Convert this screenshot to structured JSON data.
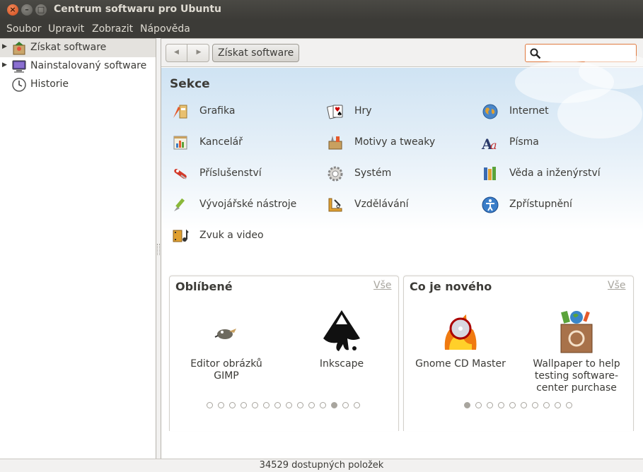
{
  "window": {
    "title": "Centrum softwaru pro Ubuntu",
    "close_glyph": "×",
    "min_glyph": "–",
    "max_glyph": "□"
  },
  "menubar": {
    "items": [
      "Soubor",
      "Upravit",
      "Zobrazit",
      "Nápověda"
    ]
  },
  "sidebar": {
    "items": [
      {
        "label": "Získat software",
        "icon": "get-software-icon",
        "expandable": true,
        "selected": true
      },
      {
        "label": "Nainstalovaný software",
        "icon": "computer-icon",
        "expandable": true,
        "selected": false
      },
      {
        "label": "Historie",
        "icon": "clock-icon",
        "expandable": false,
        "selected": false
      }
    ]
  },
  "toolbar": {
    "back_glyph": "◀",
    "forward_glyph": "▶",
    "breadcrumb": "Získat software",
    "search_placeholder": "",
    "search_value": ""
  },
  "sections": {
    "title": "Sekce",
    "categories": [
      {
        "label": "Grafika",
        "icon": "graphics-icon"
      },
      {
        "label": "Hry",
        "icon": "games-icon"
      },
      {
        "label": "Internet",
        "icon": "internet-icon"
      },
      {
        "label": "Kancelář",
        "icon": "office-icon"
      },
      {
        "label": "Motivy a tweaky",
        "icon": "themes-icon"
      },
      {
        "label": "Písma",
        "icon": "fonts-icon"
      },
      {
        "label": "Příslušenství",
        "icon": "accessories-icon"
      },
      {
        "label": "Systém",
        "icon": "system-icon"
      },
      {
        "label": "Věda a inženýrství",
        "icon": "science-icon"
      },
      {
        "label": "Vývojářské nástroje",
        "icon": "developer-tools-icon"
      },
      {
        "label": "Vzdělávání",
        "icon": "education-icon"
      },
      {
        "label": "Zpřístupnění",
        "icon": "accessibility-icon"
      },
      {
        "label": "Zvuk a video",
        "icon": "sound-video-icon"
      }
    ]
  },
  "featured": {
    "title": "Oblíbené",
    "all_label": "Vše",
    "apps": [
      {
        "label": "Editor obrázků GIMP",
        "icon": "gimp-icon"
      },
      {
        "label": "Inkscape",
        "icon": "inkscape-icon"
      }
    ],
    "pager": {
      "count": 14,
      "active": 11
    }
  },
  "whats_new": {
    "title": "Co je nového",
    "all_label": "Vše",
    "apps": [
      {
        "label": "Gnome CD Master",
        "icon": "gnome-cd-master-icon"
      },
      {
        "label": "Wallpaper to help testing software-center purchase",
        "icon": "wallpaper-package-icon"
      }
    ],
    "pager": {
      "count": 10,
      "active": 0
    }
  },
  "status": {
    "text": "34529 dostupných položek"
  },
  "colors": {
    "accent": "#e07a3f",
    "titlebar": "#3c3b37",
    "selection": "#e4e2de"
  }
}
